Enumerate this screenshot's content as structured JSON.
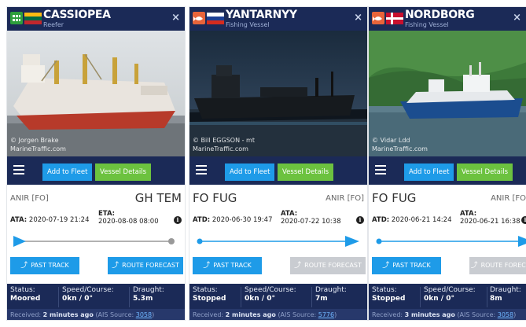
{
  "cards": [
    {
      "vessel_name": "CASSIOPEA",
      "vessel_type": "Reefer",
      "badge_color": "#2e9e3c",
      "flag": "Lithuania",
      "photo_credit_1": "© Jorgen Brake",
      "photo_credit_2": "MarineTraffic.com",
      "add_to_fleet": "Add to Fleet",
      "vessel_details": "Vessel Details",
      "origin_port": "ANIR [FO]",
      "destination_port": "GH TEM",
      "time1_label": "ATA:",
      "time1_value": "2020-07-19 21:24",
      "time2_label": "ETA:",
      "time2_value": "2020-08-08 08:00",
      "progress": 1.0,
      "past_track": "PAST TRACK",
      "route_forecast": "ROUTE FORECAST",
      "status_label": "Status:",
      "status_value": "Moored",
      "speed_label": "Speed/Course:",
      "speed_value": "0kn / 0°",
      "draught_label": "Draught:",
      "draught_value": "5.3m",
      "received_prefix": "Received:",
      "received_time": "2 minutes ago",
      "ais_text": "(AIS Source:",
      "ais_source": "3058",
      "ais_close": ")"
    },
    {
      "vessel_name": "YANTARNYY",
      "vessel_type": "Fishing Vessel",
      "badge_color": "#e8643a",
      "flag": "Russia",
      "photo_credit_1": "© Bill EGGSON - mt",
      "photo_credit_2": "MarineTraffic.com",
      "add_to_fleet": "Add to Fleet",
      "vessel_details": "Vessel Details",
      "origin_port": "FO FUG",
      "destination_port": "ANIR [FO]",
      "time1_label": "ATD:",
      "time1_value": "2020-06-30 19:47",
      "time2_label": "ATA:",
      "time2_value": "2020-07-22 10:38",
      "progress": 1.0,
      "past_track": "PAST TRACK",
      "route_forecast": "ROUTE FORECAST",
      "status_label": "Status:",
      "status_value": "Stopped",
      "speed_label": "Speed/Course:",
      "speed_value": "0kn / 0°",
      "draught_label": "Draught:",
      "draught_value": "7m",
      "received_prefix": "Received:",
      "received_time": "2 minutes ago",
      "ais_text": "(AIS Source:",
      "ais_source": "5776",
      "ais_close": ")"
    },
    {
      "vessel_name": "NORDBORG",
      "vessel_type": "Fishing Vessel",
      "badge_color": "#e8643a",
      "flag": "Denmark",
      "photo_credit_1": "© Vidar Ldd",
      "photo_credit_2": "MarineTraffic.com",
      "add_to_fleet": "Add to Fleet",
      "vessel_details": "Vessel Details",
      "origin_port": "FO FUG",
      "destination_port": "ANIR [FO",
      "time1_label": "ATD:",
      "time1_value": "2020-06-21 14:24",
      "time2_label": "ATA:",
      "time2_value": "2020-06-21 16:38",
      "progress": 1.0,
      "past_track": "PAST TRACK",
      "route_forecast": "ROUTE FORECAS",
      "status_label": "Status:",
      "status_value": "Stopped",
      "speed_label": "Speed/Course:",
      "speed_value": "0kn / 0°",
      "draught_label": "Draught:",
      "draught_value": "8m",
      "received_prefix": "Received:",
      "received_time": "3 minutes ago",
      "ais_text": "(AIS Source:",
      "ais_source": "3058",
      "ais_close": ")"
    }
  ],
  "colors": {
    "header_bg": "#1b2a57",
    "blue_button": "#1e9be8",
    "green_button": "#6cc23f",
    "disabled_button": "#c9ccd1"
  }
}
